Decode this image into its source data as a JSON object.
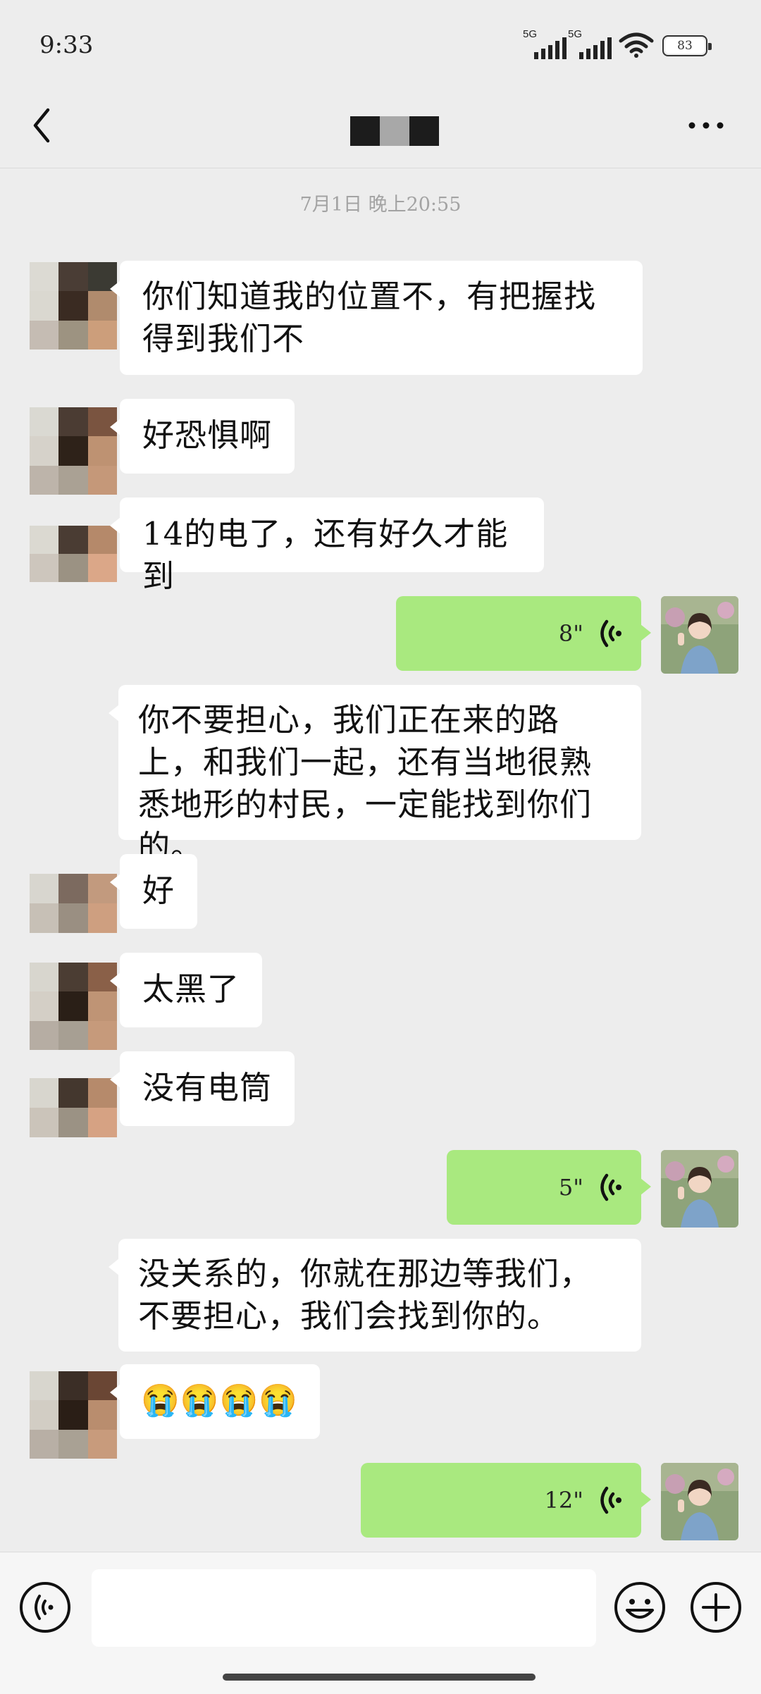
{
  "status_bar": {
    "time": "9:33",
    "signal1": "5G",
    "signal2": "5G",
    "battery": "83"
  },
  "header": {
    "back_icon": "chevron-left-icon",
    "more_icon": "more-dots-icon"
  },
  "timestamp": "7月1日 晚上20:55",
  "messages": [
    {
      "side": "received",
      "text": "你们知道我的位置不，有把握找得到我们不"
    },
    {
      "side": "received",
      "text": "好恐惧啊"
    },
    {
      "side": "received",
      "text": "14的电了，还有好久才能到"
    },
    {
      "side": "sent",
      "type": "voice",
      "duration": "8\""
    },
    {
      "side": "received",
      "text": "你不要担心，我们正在来的路上，和我们一起，还有当地很熟悉地形的村民，一定能找到你们的。"
    },
    {
      "side": "received",
      "text": "好"
    },
    {
      "side": "received",
      "text": "太黑了"
    },
    {
      "side": "received",
      "text": "没有电筒"
    },
    {
      "side": "sent",
      "type": "voice",
      "duration": "5\""
    },
    {
      "side": "received",
      "text": "没关系的，你就在那边等我们，不要担心，我们会找到你的。"
    },
    {
      "side": "received",
      "text": "😭😭😭😭"
    },
    {
      "side": "sent",
      "type": "voice",
      "duration": "12\""
    }
  ],
  "input_bar": {
    "placeholder": "",
    "voice_icon": "voice-input-icon",
    "emoji_icon": "emoji-icon",
    "plus_icon": "plus-icon"
  },
  "colors": {
    "background": "#ededed",
    "sent_bubble": "#a9e97f",
    "received_bubble": "#ffffff"
  }
}
